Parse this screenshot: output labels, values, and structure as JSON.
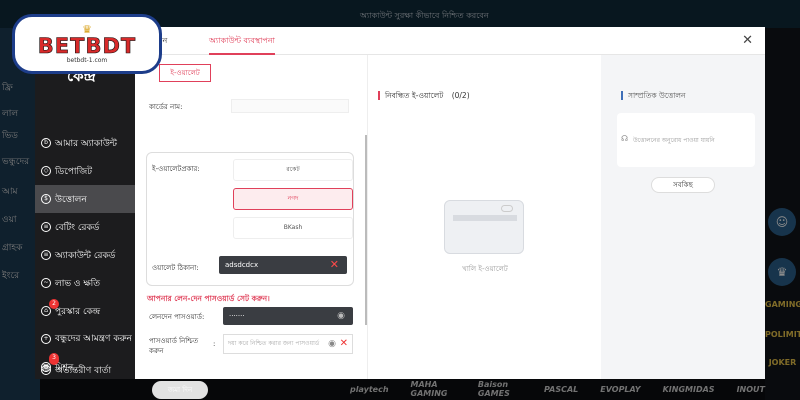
{
  "background": {
    "top_bar_text": "অ্যাকাউন্ট সুরক্ষা কীভাবে নিশ্চিত করবেন",
    "left_items": [
      "ফ্রি",
      "লাল",
      "ভিড",
      "ভন্ধুদের",
      "আম",
      "ওয়া",
      "গ্রাহক",
      "ইংরে"
    ],
    "right_items": [
      "GAMING",
      "POLIMIT",
      "JOKER"
    ],
    "providers": [
      "playtech",
      "MAHA GAMING",
      "Baison GAMES",
      "PASCAL",
      "EVOPLAY",
      "KINGMIDAS",
      "INOUT"
    ]
  },
  "logo": {
    "text": "BETBDT",
    "sub": "betbdt-1.com"
  },
  "tabs": {
    "tab1": "উত্তোলন",
    "tab2": "অ্যাকাউন্ট ব্যবস্থাপনা"
  },
  "sidebar": {
    "title": "কেন্দ্র",
    "items": [
      {
        "label": "আমার অ্যাকাউন্ট",
        "icon": "b"
      },
      {
        "label": "ডিপোজিট",
        "icon": "◇"
      },
      {
        "label": "উত্তোলন",
        "icon": "$"
      },
      {
        "label": "বেটিং রেকর্ড",
        "icon": "≡"
      },
      {
        "label": "অ্যাকাউন্ট রেকর্ড",
        "icon": "≡"
      },
      {
        "label": "লাভ ও ক্ষতি",
        "icon": "~"
      },
      {
        "label": "পুরস্কার কেন্দ্র",
        "icon": "⌂"
      },
      {
        "label": "বন্ধুদের আমন্ত্রণ করুন",
        "icon": "+"
      },
      {
        "label": "মিশন",
        "icon": "▦"
      },
      {
        "label": "অভ্যন্তরীণ বার্তা",
        "icon": "@"
      }
    ],
    "badge_rewards": "2",
    "badge_mission": "1",
    "badge_messages": "3"
  },
  "form": {
    "ewallet_tab": "ই-ওয়ালেট",
    "account_name_label": "কার্ডের নাম:",
    "wallet_type_label": "ই-ওয়ালেটপ্রকার:",
    "wallet_options": [
      "রকেট",
      "নগদ",
      "BKash"
    ],
    "wallet_address_label": "ওয়ালেট ঠিকানা:",
    "wallet_address_value": "adsdcdcx",
    "warning": "আপনার লেন-দেন পাসওয়ার্ড সেট করুন।",
    "tx_password_label": "লেনদেন পাসওয়ার্ড:",
    "tx_password_value": "·······",
    "confirm_password_label": "পাসওয়ার্ড নিশ্চিত করুন",
    "confirm_password_colon": ":",
    "confirm_password_placeholder": "দয়া করে নিশ্চিত করার জন্য পাসওয়ার্ড",
    "submit_label": "জমা দিন"
  },
  "wallets": {
    "title": "নিবন্ধিত ই-ওয়ালেট",
    "count": "(0/2)",
    "empty_text": "খালি ই-ওয়ালেট"
  },
  "recent": {
    "title": "সাম্প্রতিক উত্তোলন",
    "no_record": "উত্তোলনের অনুরোধ পাওয়া যায়নি",
    "all_button": "সবকিছ"
  },
  "colors": {
    "accent": "#e0405a",
    "sidebar_bg": "#1c1c1e",
    "input_dark": "#3a3d42"
  }
}
